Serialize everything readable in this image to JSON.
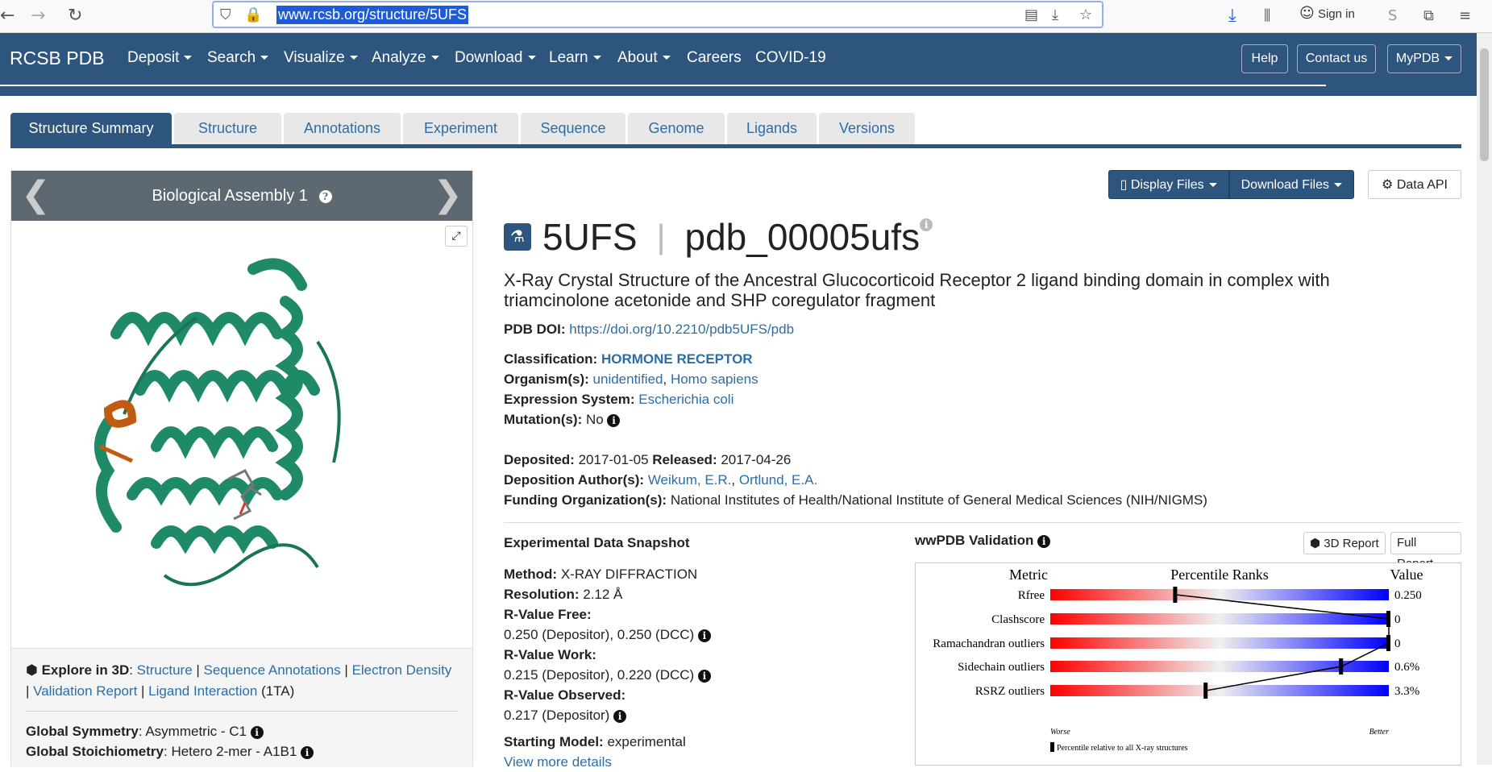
{
  "browser": {
    "url": "www.rcsb.org/structure/5UFS",
    "sign_in": "Sign in"
  },
  "nav": {
    "brand": "RCSB PDB",
    "items": [
      "Deposit",
      "Search",
      "Visualize",
      "Analyze",
      "Download",
      "Learn",
      "About",
      "Careers",
      "COVID-19"
    ],
    "help": "Help",
    "contact": "Contact us",
    "mypdb": "MyPDB"
  },
  "tabs": [
    "Structure Summary",
    "Structure",
    "Annotations",
    "Experiment",
    "Sequence",
    "Genome",
    "Ligands",
    "Versions"
  ],
  "assembly": {
    "title": "Biological Assembly 1"
  },
  "explore": {
    "label": "Explore in 3D",
    "links": [
      "Structure",
      "Sequence Annotations",
      "Electron Density",
      "Validation Report",
      "Ligand Interaction"
    ],
    "ligand_code": "(1TA)",
    "symmetry_label": "Global Symmetry",
    "symmetry": "Asymmetric - C1",
    "stoich_label": "Global Stoichiometry",
    "stoich": "Hetero 2-mer - A1B1"
  },
  "buttons": {
    "display_files": "Display Files",
    "download_files": "Download Files",
    "data_api": "Data API"
  },
  "entry": {
    "id": "5UFS",
    "ext_id": "pdb_00005ufs",
    "title": "X-Ray Crystal Structure of the Ancestral Glucocorticoid Receptor 2 ligand binding domain in complex with triamcinolone acetonide and SHP coregulator fragment",
    "doi_label": "PDB DOI:",
    "doi": "https://doi.org/10.2210/pdb5UFS/pdb",
    "classification_label": "Classification:",
    "classification": "HORMONE RECEPTOR",
    "organism_label": "Organism(s):",
    "organism1": "unidentified",
    "organism2": "Homo sapiens",
    "expression_label": "Expression System:",
    "expression": "Escherichia coli",
    "mutation_label": "Mutation(s):",
    "mutation": "No",
    "deposited_label": "Deposited:",
    "deposited": "2017-01-05",
    "released_label": "Released:",
    "released": "2017-04-26",
    "authors_label": "Deposition Author(s):",
    "author1": "Weikum, E.R.",
    "author2": "Ortlund, E.A.",
    "funding_label": "Funding Organization(s):",
    "funding": "National Institutes of Health/National Institute of General Medical Sciences (NIH/NIGMS)"
  },
  "snapshot": {
    "heading": "Experimental Data Snapshot",
    "method_label": "Method:",
    "method": "X-RAY DIFFRACTION",
    "resolution_label": "Resolution:",
    "resolution": "2.12 Å",
    "rfree_label": "R-Value Free:",
    "rfree": "0.250 (Depositor), 0.250 (DCC)",
    "rwork_label": "R-Value Work:",
    "rwork": "0.215 (Depositor), 0.220 (DCC)",
    "robs_label": "R-Value Observed:",
    "robs": "0.217 (Depositor)",
    "start_label": "Starting Model:",
    "start": "experimental",
    "more": "View more details"
  },
  "validation": {
    "heading": "wwPDB Validation",
    "report3d": "3D Report",
    "full": "Full Report",
    "col_metric": "Metric",
    "col_rank": "Percentile Ranks",
    "col_value": "Value",
    "metrics": [
      {
        "name": "Rfree",
        "value": "0.250",
        "pct": 0.37
      },
      {
        "name": "Clashscore",
        "value": "0",
        "pct": 1.0
      },
      {
        "name": "Ramachandran outliers",
        "value": "0",
        "pct": 1.0
      },
      {
        "name": "Sidechain outliers",
        "value": "0.6%",
        "pct": 0.86
      },
      {
        "name": "RSRZ outliers",
        "value": "3.3%",
        "pct": 0.46
      }
    ],
    "worse": "Worse",
    "better": "Better",
    "legend": "Percentile relative to all X-ray structures"
  }
}
